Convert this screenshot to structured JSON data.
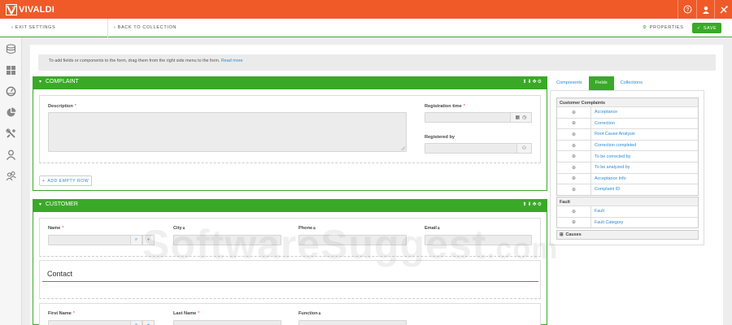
{
  "app": {
    "logo_text": "VIVALDI"
  },
  "header": {
    "icons": [
      "help-icon",
      "user-icon",
      "tools-icon"
    ]
  },
  "toolbar": {
    "exit_settings": "EXIT SETTINGS",
    "back_to_collection": "BACK TO COLLECTION",
    "properties": "PROPERTIES",
    "save": "SAVE"
  },
  "sidebar": {
    "icons": [
      "database-icon",
      "grid-icon",
      "dashboard-icon",
      "pie-chart-icon",
      "wrench-icon",
      "person-icon",
      "users-icon"
    ]
  },
  "info": {
    "text": "To add fields or components to the form, drag them from the right side menu to the form.",
    "link": "Read more"
  },
  "complaint": {
    "title": "COMPLAINT",
    "description_label": "Description",
    "registration_time_label": "Registration time",
    "registered_by_label": "Registered by",
    "add_empty_row": "ADD EMPTY ROW"
  },
  "customer": {
    "title": "CUSTOMER",
    "name_label": "Name",
    "city_label": "City",
    "phone_label": "Phone",
    "email_label": "Email",
    "contact_title": "Contact",
    "first_name_label": "First Name",
    "last_name_label": "Last Name",
    "function_label": "Function"
  },
  "right_panel": {
    "tabs": [
      "Components",
      "Fields",
      "Collections"
    ],
    "active_tab": "Fields",
    "groups": [
      {
        "title": "Customer Complaints",
        "items": [
          "Acceptance",
          "Correction",
          "Root Cause Analysis",
          "Correction completed",
          "To be corrected by",
          "To be analyzed by",
          "Acceptance Info",
          "Complaint ID"
        ]
      },
      {
        "title": "Fault",
        "items": [
          "Fault",
          "Fault Category"
        ]
      }
    ],
    "collapsed_group": "Causes"
  },
  "watermark": {
    "text": "SoftwareSuggest",
    "suffix": ".com"
  },
  "colors": {
    "brand_orange": "#ef5a28",
    "accent_green": "#3aa928",
    "link_blue": "#2a8ad0"
  }
}
